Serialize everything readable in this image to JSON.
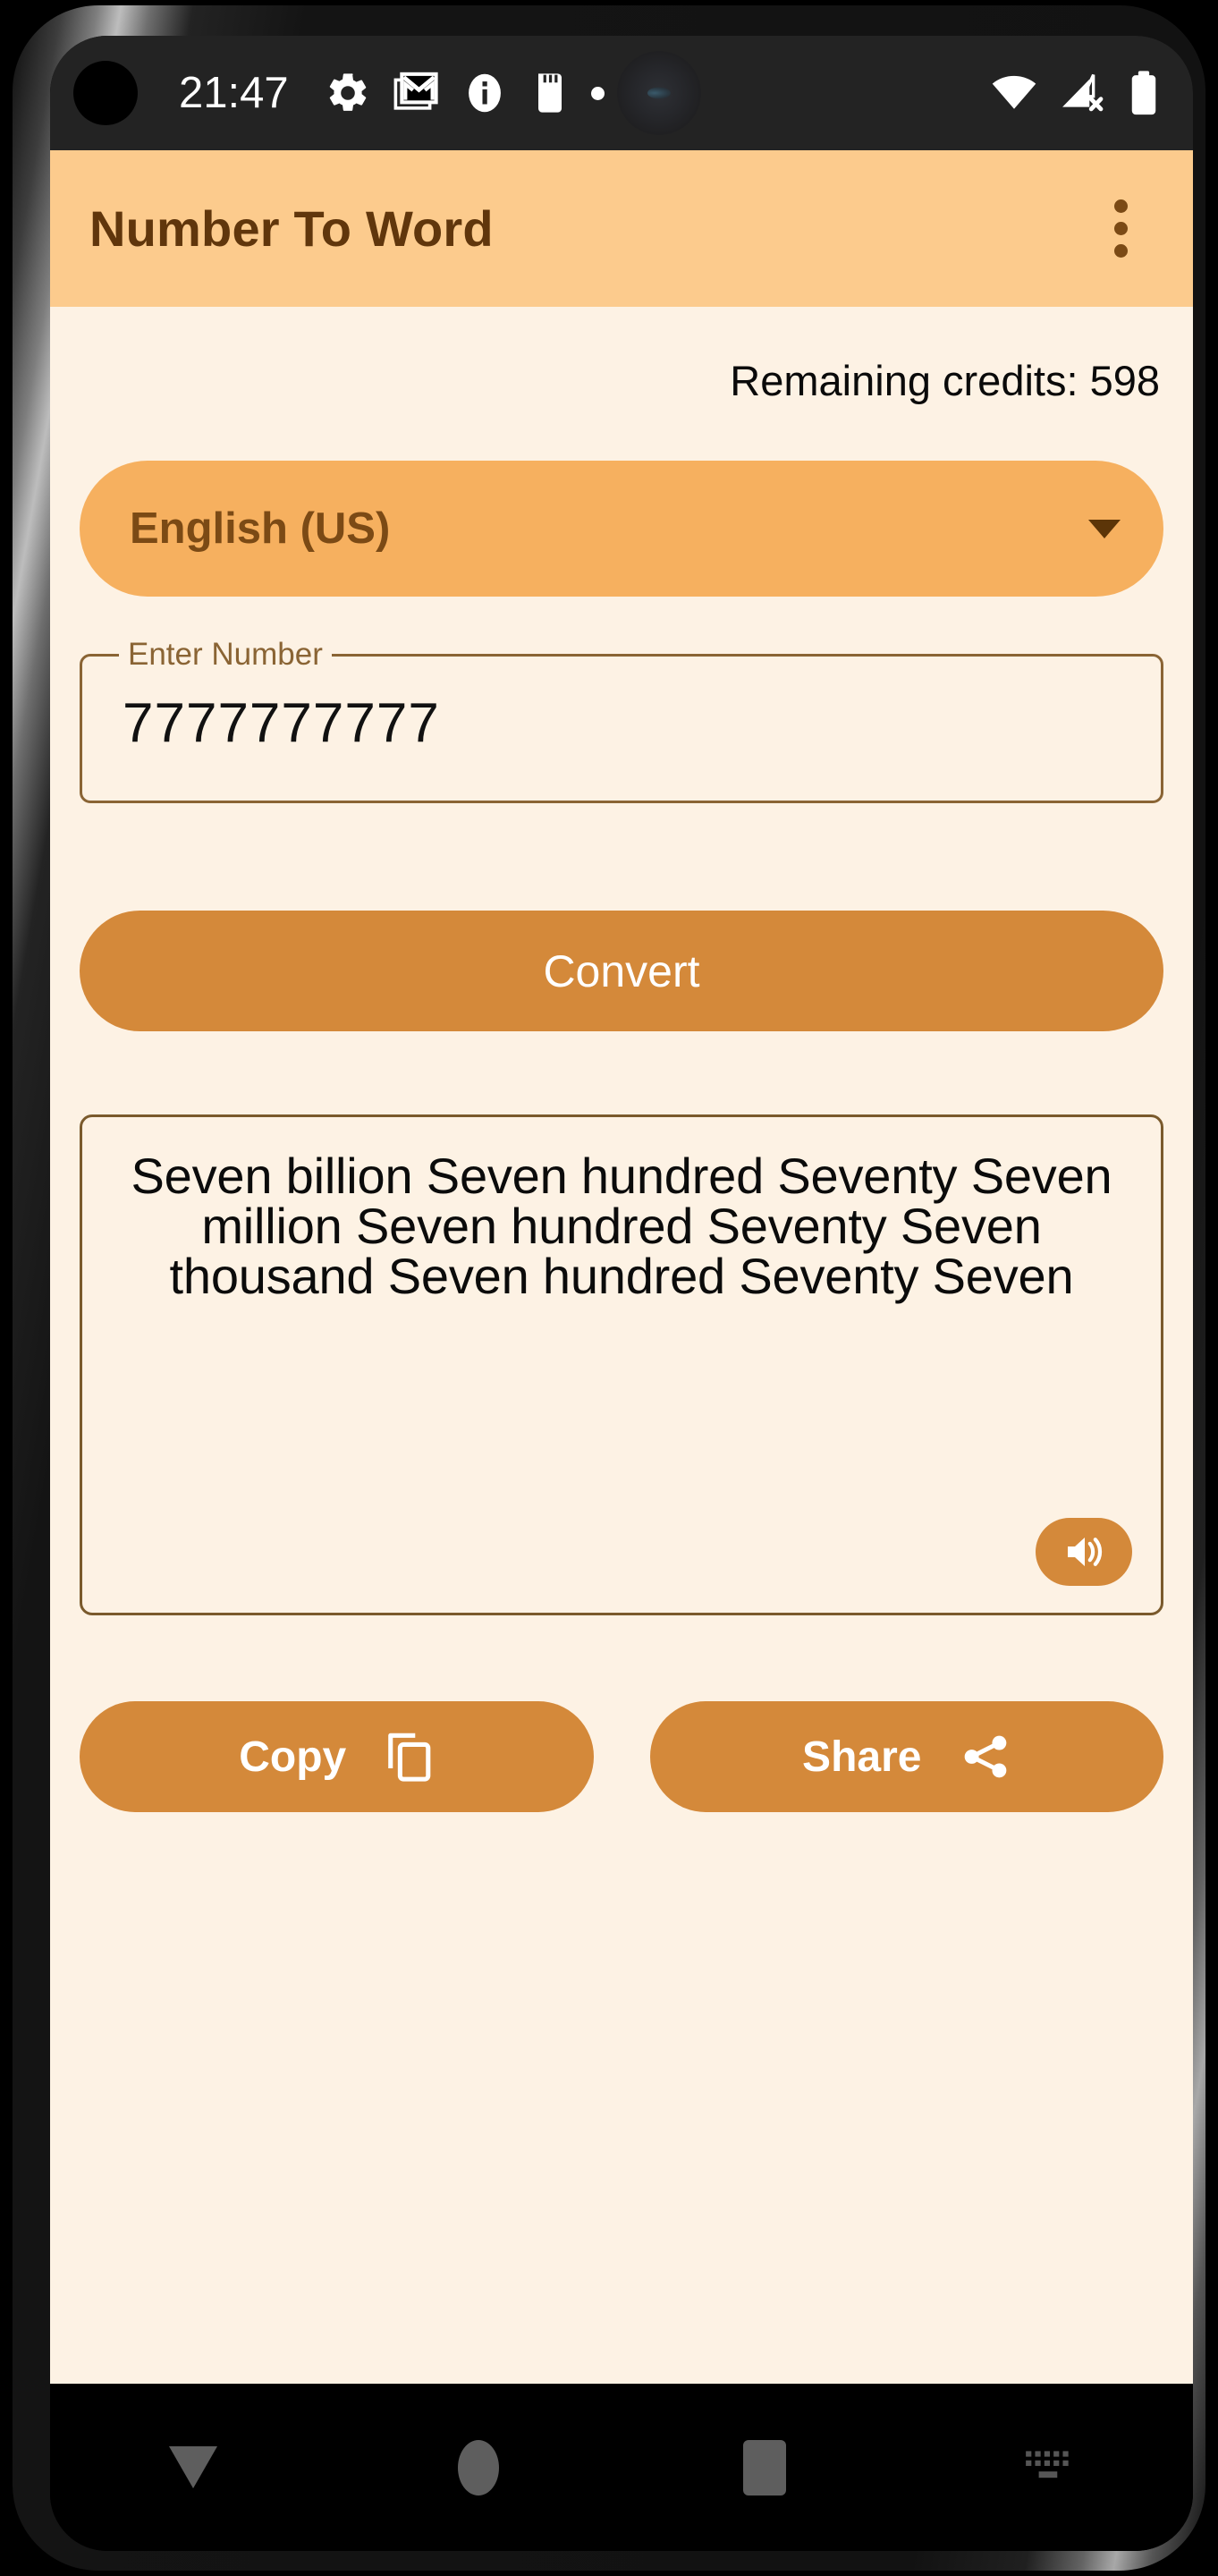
{
  "status_bar": {
    "time": "21:47",
    "left_icons": [
      "settings-gear-icon",
      "gmail-icon",
      "info-icon",
      "sd-card-icon",
      "dot-icon"
    ],
    "right_icons": [
      "wifi-icon",
      "cellular-no-sim-icon",
      "battery-icon"
    ]
  },
  "app_bar": {
    "title": "Number To Word",
    "overflow_icon": "more-vert-icon",
    "background_color": "#FCCB8D",
    "title_color": "#60360C"
  },
  "content": {
    "credits_text": "Remaining credits: 598",
    "language": {
      "selected": "English (US)",
      "arrow_icon": "chevron-down-icon",
      "background_color": "#F6B05F",
      "text_color": "#7B4A15"
    },
    "number_input": {
      "label": "Enter Number",
      "value": "7777777777",
      "placeholder": "Enter Number"
    },
    "convert_button": {
      "label": "Convert",
      "color": "#D4893A"
    },
    "result": {
      "text": "Seven billion Seven hundred Seventy Seven million Seven hundred Seventy Seven thousand Seven hundred Seventy Seven",
      "speak_icon": "volume-up-icon"
    },
    "actions": [
      {
        "label": "Copy",
        "icon": "copy-icon"
      },
      {
        "label": "Share",
        "icon": "share-icon"
      }
    ],
    "background_color": "#FDF2E4"
  },
  "nav_bar": {
    "items": [
      {
        "name": "back",
        "icon": "back-triangle-icon"
      },
      {
        "name": "home",
        "icon": "home-circle-icon"
      },
      {
        "name": "recents",
        "icon": "recents-square-icon"
      },
      {
        "name": "keyboard",
        "icon": "keyboard-icon"
      }
    ]
  }
}
